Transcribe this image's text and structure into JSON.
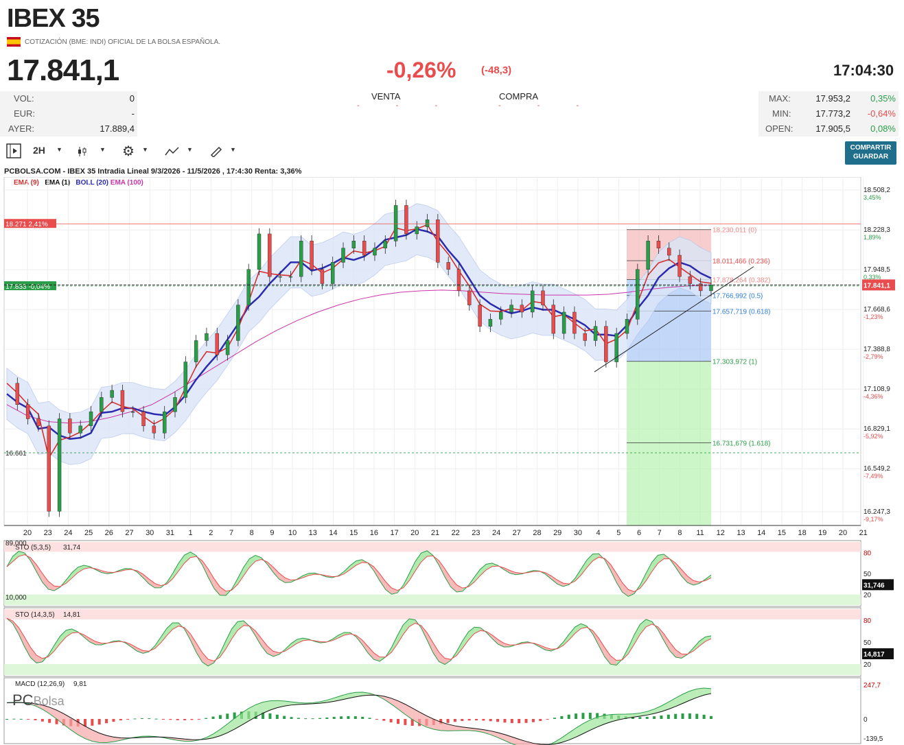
{
  "header": {
    "title": "IBEX 35",
    "subtitle": "COTIZACIÓN (BME: INDI) OFICIAL DE LA BOLSA ESPAÑOLA.",
    "flag_icon": "spain-flag-icon",
    "price": "17.841,1",
    "change_pct": "-0,26%",
    "change_abs": "(-48,3)",
    "time": "17:04:30"
  },
  "stats_left": [
    {
      "label": "VOL:",
      "value": "0"
    },
    {
      "label": "EUR:",
      "value": "-"
    },
    {
      "label": "AYER:",
      "value": "17.889,4"
    }
  ],
  "quote": {
    "sell_label": "VENTA",
    "buy_label": "COMPRA",
    "sell_value": "- - -",
    "buy_value": "- - -"
  },
  "stats_right": [
    {
      "label": "MAX:",
      "value": "17.953,2",
      "pct": "0,35%",
      "sign": "pos"
    },
    {
      "label": "MIN:",
      "value": "17.773,2",
      "pct": "-0,64%",
      "sign": "neg"
    },
    {
      "label": "OPEN:",
      "value": "17.905,5",
      "pct": "0,08%",
      "sign": "pos"
    }
  ],
  "toolbar": {
    "timeframe": "2H",
    "share_label_1": "COMPARTIR",
    "share_label_2": "GUARDAR"
  },
  "chart_head": "PCBOLSA.COM - IBEX 35 Intradia Lineal 9/3/2026 - 11/5/2026 , 17:4:30 Renta: 3,36%",
  "legend": [
    {
      "text": "EMA (9)",
      "color": "#d32f2f"
    },
    {
      "text": "EMA (1)",
      "color": "#111111"
    },
    {
      "text": "BOLL (20)",
      "color": "#2b2bb0"
    },
    {
      "text": "EMA (100)",
      "color": "#cc33aa"
    }
  ],
  "colors": {
    "up": "#2a9d48",
    "down": "#e84c4c",
    "boll": "#2b2bb0",
    "ema9": "#d32f2f",
    "ema100": "#cc33aa",
    "band": "#dbe6f8"
  },
  "chart_data": {
    "type": "line",
    "y_ticks": [
      {
        "value": "18.508,2",
        "pct": "3,45%"
      },
      {
        "value": "18.228,3",
        "pct": "1,89%"
      },
      {
        "value": "17.948,5",
        "pct": "0,33%"
      },
      {
        "value": "17.668,6",
        "pct": "-1,23%"
      },
      {
        "value": "17.388,8",
        "pct": "-2,79%"
      },
      {
        "value": "17.108,9",
        "pct": "-4,36%"
      },
      {
        "value": "16.829,1",
        "pct": "-5,92%"
      },
      {
        "value": "16.549,2",
        "pct": "-7,49%"
      },
      {
        "value": "16.247,3",
        "pct": "-9,17%"
      }
    ],
    "ylim": [
      16150,
      18600
    ],
    "x_labels": [
      "20",
      "23",
      "24",
      "25",
      "26",
      "27",
      "30",
      "31",
      "1",
      "2",
      "7",
      "8",
      "9",
      "10",
      "13",
      "14",
      "15",
      "16",
      "17",
      "20",
      "21",
      "22",
      "23",
      "24",
      "27",
      "28",
      "29",
      "30",
      "4",
      "5",
      "6",
      "7",
      "8",
      "11",
      "12",
      "13",
      "14",
      "15",
      "18",
      "19",
      "20",
      "21"
    ],
    "price_path": [
      17150,
      17000,
      16900,
      16850,
      16250,
      16900,
      16800,
      16850,
      16950,
      17050,
      17100,
      16950,
      16950,
      16850,
      16800,
      16950,
      17050,
      17300,
      17450,
      17500,
      17350,
      17450,
      17700,
      17950,
      18200,
      17900,
      17900,
      17900,
      18150,
      17950,
      17850,
      18000,
      18100,
      18150,
      18050,
      18100,
      18150,
      18400,
      18200,
      18250,
      18300,
      18000,
      17950,
      17800,
      17700,
      17550,
      17600,
      17650,
      17700,
      17650,
      17800,
      17700,
      17500,
      17650,
      17500,
      17450,
      17550,
      17300,
      17500,
      17600,
      17950,
      18150,
      18100,
      18050,
      17900,
      17850,
      17800,
      17841
    ],
    "ema100_path": [
      17000,
      16920,
      16880,
      16870,
      16880,
      16910,
      16950,
      17000,
      17080,
      17170,
      17260,
      17350,
      17440,
      17520,
      17590,
      17650,
      17700,
      17740,
      17770,
      17790,
      17800,
      17805,
      17800,
      17790,
      17780,
      17775,
      17770,
      17770,
      17770,
      17775,
      17790,
      17810,
      17825,
      17835,
      17840
    ],
    "hlines": [
      {
        "value": 18271,
        "label": "18.271  2,41%",
        "color": "#e84c4c"
      },
      {
        "value": 17833,
        "label": "17.833  -0,04%",
        "color": "#2a9d48"
      },
      {
        "value": 16661,
        "label": "16.661",
        "color": "#2a9d48"
      }
    ],
    "fib_levels": [
      {
        "value": 18230.011,
        "label": "18.230,011 (0)",
        "color": "#e88"
      },
      {
        "value": 18011.466,
        "label": "18.011,466 (0.236)",
        "color": "#e84c4c"
      },
      {
        "value": 17878.264,
        "label": "17.878,264 (0.382)",
        "color": "#e88"
      },
      {
        "value": 17766.992,
        "label": "17.766,992 (0.5)",
        "color": "#2f7fd6"
      },
      {
        "value": 17657.719,
        "label": "17.657,719 (0.618)",
        "color": "#2f7fd6"
      },
      {
        "value": 17303.972,
        "label": "17.303,972 (1)",
        "color": "#2a9d48"
      },
      {
        "value": 16731.679,
        "label": "16.731,679 (1.618)",
        "color": "#2a9d48"
      }
    ],
    "last_price_tag": "17.841,1"
  },
  "indicators": {
    "sto1": {
      "label": "STO (5,3,5)",
      "value": "31,74",
      "tag": "31,746",
      "hi_label": "89,000",
      "lo_label": "10,000",
      "ticks": [
        "80",
        "50",
        "20"
      ]
    },
    "sto2": {
      "label": "STO (14,3,5)",
      "value": "14,81",
      "tag": "14,817",
      "ticks": [
        "80",
        "50",
        "20"
      ]
    },
    "macd": {
      "label": "MACD (12,26,9)",
      "value": "9,81",
      "ticks": [
        "247,7",
        "0",
        "-139,5"
      ]
    }
  },
  "logo": {
    "pc": "PC",
    "bolsa": "Bolsa"
  }
}
